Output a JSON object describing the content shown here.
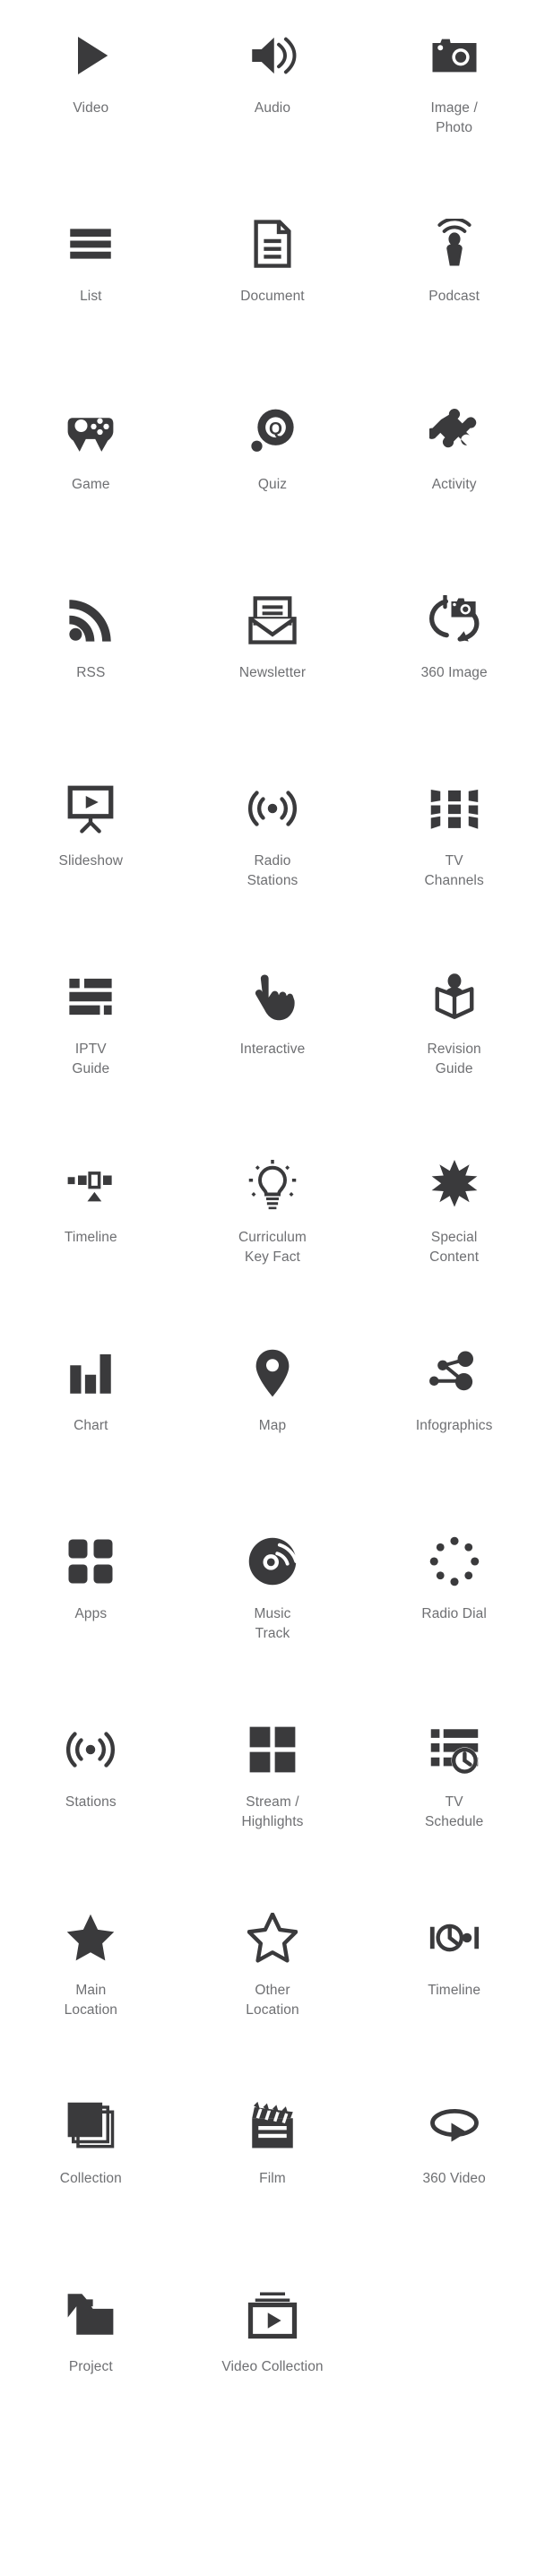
{
  "palette": {
    "background": "#ffffff",
    "icon_color": "#3a3a3c",
    "label_color": "#6e6f72"
  },
  "grid": {
    "columns": 3,
    "rows": 13,
    "total_items": 38
  },
  "icons": [
    {
      "label": "Video",
      "icon": "play-triangle-icon"
    },
    {
      "label": "Audio",
      "icon": "speaker-waves-icon"
    },
    {
      "label": "Image /\nPhoto",
      "icon": "camera-icon"
    },
    {
      "label": "List",
      "icon": "list-bars-icon"
    },
    {
      "label": "Document",
      "icon": "document-page-icon"
    },
    {
      "label": "Podcast",
      "icon": "podcast-microphone-icon"
    },
    {
      "label": "Game",
      "icon": "gamepad-icon"
    },
    {
      "label": "Quiz",
      "icon": "quiz-q-circle-icon"
    },
    {
      "label": "Activity",
      "icon": "puzzle-piece-icon"
    },
    {
      "label": "RSS",
      "icon": "rss-feed-icon"
    },
    {
      "label": "Newsletter",
      "icon": "newsletter-envelope-icon"
    },
    {
      "label": "360 Image",
      "icon": "camera-360-icon"
    },
    {
      "label": "Slideshow",
      "icon": "slideshow-projector-icon"
    },
    {
      "label": "Radio\nStations",
      "icon": "broadcast-waves-icon"
    },
    {
      "label": "TV\nChannels",
      "icon": "tv-channels-grid-icon"
    },
    {
      "label": "IPTV\nGuide",
      "icon": "iptv-guide-blocks-icon"
    },
    {
      "label": "Interactive",
      "icon": "pointing-hand-icon"
    },
    {
      "label": "Revision\nGuide",
      "icon": "person-reading-book-icon"
    },
    {
      "label": "Timeline",
      "icon": "timeline-markers-icon"
    },
    {
      "label": "Curriculum\nKey Fact",
      "icon": "lightbulb-icon"
    },
    {
      "label": "Special\nContent",
      "icon": "starburst-icon"
    },
    {
      "label": "Chart",
      "icon": "bar-chart-icon"
    },
    {
      "label": "Map",
      "icon": "map-pin-icon"
    },
    {
      "label": "Infographics",
      "icon": "node-network-icon"
    },
    {
      "label": "Apps",
      "icon": "apps-rounded-squares-icon"
    },
    {
      "label": "Music\nTrack",
      "icon": "vinyl-disc-icon"
    },
    {
      "label": "Radio Dial",
      "icon": "radio-dial-dots-icon"
    },
    {
      "label": "Stations",
      "icon": "broadcast-waves-icon"
    },
    {
      "label": "Stream /\nHighlights",
      "icon": "four-squares-icon"
    },
    {
      "label": "TV\nSchedule",
      "icon": "schedule-clock-list-icon"
    },
    {
      "label": "Main\nLocation",
      "icon": "star-filled-icon"
    },
    {
      "label": "Other\nLocation",
      "icon": "star-outline-icon"
    },
    {
      "label": "Timeline",
      "icon": "clock-timeline-icon"
    },
    {
      "label": "Collection",
      "icon": "stacked-squares-icon"
    },
    {
      "label": "Film",
      "icon": "clapperboard-icon"
    },
    {
      "label": "360 Video",
      "icon": "video-360-orbit-icon"
    },
    {
      "label": "Project",
      "icon": "folder-icon"
    },
    {
      "label": "Video Collection",
      "icon": "video-collection-icon"
    }
  ]
}
